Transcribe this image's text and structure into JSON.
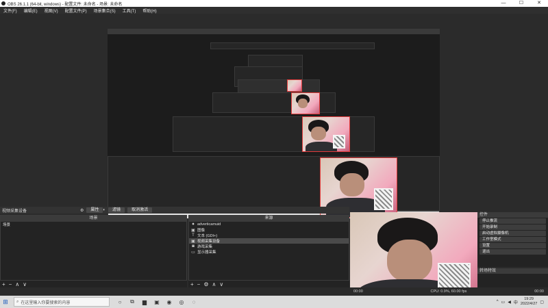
{
  "window": {
    "title": "OBS 26.1.1 (64-bit, windows) - 配置文件: 未命名 - 场景: 未命名",
    "minimize": "—",
    "maximize": "☐",
    "close": "✕"
  },
  "menu": [
    "文件(F)",
    "编辑(E)",
    "视图(V)",
    "配置文件(P)",
    "场景集合(S)",
    "工具(T)",
    "帮助(H)"
  ],
  "context_bar": {
    "label": "视频采集设备",
    "properties": "属性",
    "filters": "滤镜",
    "deactivate": "取消激活"
  },
  "scenes_panel": {
    "header": "场景",
    "items": [
      "场景"
    ]
  },
  "sources_panel": {
    "header": "来源",
    "items": [
      {
        "icon": "⏺",
        "label": "adverticamuid"
      },
      {
        "icon": "▣",
        "label": "图像"
      },
      {
        "icon": "T",
        "label": "文本 (GDI+)"
      },
      {
        "icon": "▣",
        "label": "视频采集设备"
      },
      {
        "icon": "◙",
        "label": "游戏采集"
      },
      {
        "icon": "▭",
        "label": "显示器采集"
      }
    ],
    "selected_index": 3
  },
  "toolbar_icons": [
    "+",
    "−",
    "∧",
    "∨"
  ],
  "source_toolbar_icons": [
    "+",
    "−",
    "⚙",
    "∧",
    "∨"
  ],
  "controls": {
    "header": "控件",
    "buttons": [
      "停止推流",
      "开始录制",
      "启动虚拟摄像机",
      "工作室模式",
      "设置",
      "退出"
    ]
  },
  "transition_header": "转场特效",
  "status": {
    "left": "00:00",
    "cpu": "CPU: 0.9%, 60.00 fps",
    "rec": "00:00"
  },
  "taskbar": {
    "search_placeholder": "在这里输入你要搜索的内容",
    "time": "19:29",
    "date": "2022/4/27",
    "lang": "中"
  },
  "colors": {
    "accent_red": "#e23b3b",
    "panel_bg": "#232323",
    "window_bg": "#2b2b2b"
  }
}
